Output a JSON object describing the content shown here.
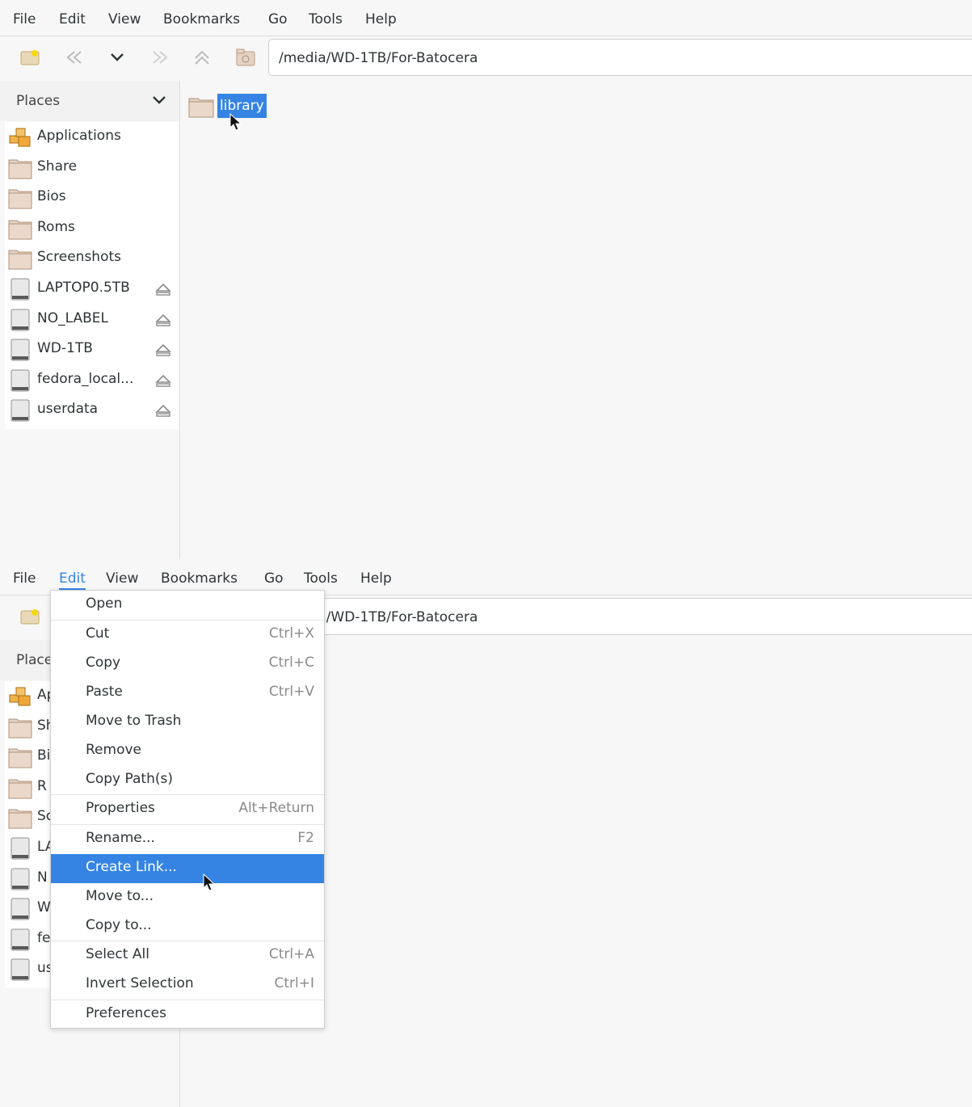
{
  "menubar": {
    "items": [
      "File",
      "Edit",
      "View",
      "Bookmarks",
      "Go",
      "Tools",
      "Help"
    ],
    "active": "Edit"
  },
  "toolbar": {
    "path": "/media/WD-1TB/For-Batocera"
  },
  "sidebar": {
    "header": "Places",
    "items": [
      {
        "label": "Applications",
        "icon": "applications-icon"
      },
      {
        "label": "Share",
        "icon": "folder-icon"
      },
      {
        "label": "Bios",
        "icon": "folder-icon"
      },
      {
        "label": "Roms",
        "icon": "folder-icon"
      },
      {
        "label": "Screenshots",
        "icon": "folder-icon"
      },
      {
        "label": "LAPTOP0.5TB",
        "icon": "drive-icon",
        "eject": true
      },
      {
        "label": "NO_LABEL",
        "icon": "drive-icon",
        "eject": true
      },
      {
        "label": "WD-1TB",
        "icon": "drive-icon",
        "eject": true
      },
      {
        "label": "fedora_local...",
        "icon": "drive-icon",
        "eject": true
      },
      {
        "label": "userdata",
        "icon": "drive-icon",
        "eject": true
      }
    ],
    "truncated_labels": [
      "Ap",
      "Sh",
      "Bi",
      "R",
      "Sc",
      "LA",
      "N",
      "W",
      "fe",
      "us"
    ]
  },
  "content": {
    "files": [
      {
        "name": "library",
        "selected": true
      }
    ]
  },
  "edit_menu": {
    "items": [
      {
        "label": "Open",
        "accel": ""
      },
      {
        "label": "Cut",
        "accel": "Ctrl+X"
      },
      {
        "label": "Copy",
        "accel": "Ctrl+C"
      },
      {
        "label": "Paste",
        "accel": "Ctrl+V"
      },
      {
        "label": "Move to Trash",
        "accel": ""
      },
      {
        "label": "Remove",
        "accel": ""
      },
      {
        "label": "Copy Path(s)",
        "accel": ""
      },
      {
        "label": "Properties",
        "accel": "Alt+Return"
      },
      {
        "label": "Rename...",
        "accel": "F2"
      },
      {
        "label": "Create Link...",
        "accel": "",
        "highlighted": true
      },
      {
        "label": "Move to...",
        "accel": ""
      },
      {
        "label": "Copy to...",
        "accel": ""
      },
      {
        "label": "Select All",
        "accel": "Ctrl+A"
      },
      {
        "label": "Invert Selection",
        "accel": "Ctrl+I"
      },
      {
        "label": "Preferences",
        "accel": ""
      }
    ]
  },
  "colors": {
    "accent": "#3584e4",
    "folder": "#e4d3c4",
    "text": "#2e3436"
  }
}
